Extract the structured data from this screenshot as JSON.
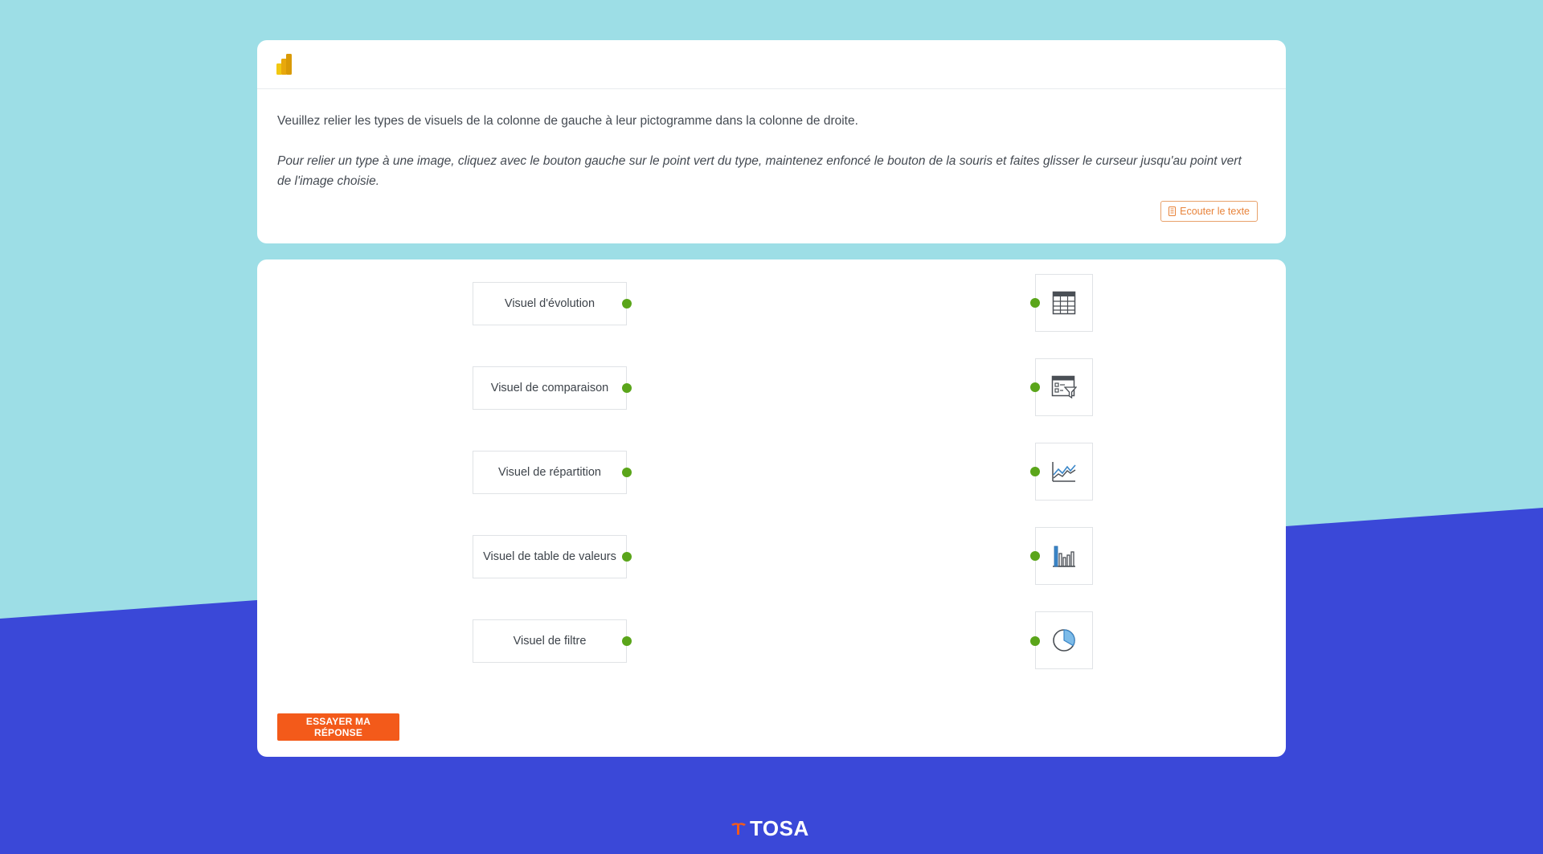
{
  "colors": {
    "background_top": "#9ddee6",
    "background_bottom": "#3a48d8",
    "connector_dot": "#5aa51a",
    "submit_button": "#f35a1a",
    "listen_button": "#e8833a"
  },
  "header": {
    "logo_icon": "power-bi-logo-icon"
  },
  "instructions": {
    "main": "Veuillez relier les types de visuels de la colonne de gauche à leur pictogramme dans la colonne de droite.",
    "help": "Pour relier un type à une image, cliquez avec le bouton gauche sur le point vert du type, maintenez enfoncé le bouton de la souris et faites glisser le curseur jusqu'au point vert de l'image choisie.",
    "listen_label": "Ecouter le texte",
    "listen_icon": "phone-speaker-icon"
  },
  "matching": {
    "left_items": [
      {
        "label": "Visuel d'évolution"
      },
      {
        "label": "Visuel de comparaison"
      },
      {
        "label": "Visuel de répartition"
      },
      {
        "label": "Visuel de table de valeurs"
      },
      {
        "label": "Visuel de filtre"
      }
    ],
    "right_icons": [
      {
        "icon": "table-grid-icon"
      },
      {
        "icon": "slicer-filter-icon"
      },
      {
        "icon": "line-chart-icon"
      },
      {
        "icon": "bar-chart-icon"
      },
      {
        "icon": "pie-chart-icon"
      }
    ]
  },
  "submit_label": "ESSAYER MA RÉPONSE",
  "footer": {
    "brand": "TOSA",
    "brand_icon": "tosa-logo-icon"
  }
}
